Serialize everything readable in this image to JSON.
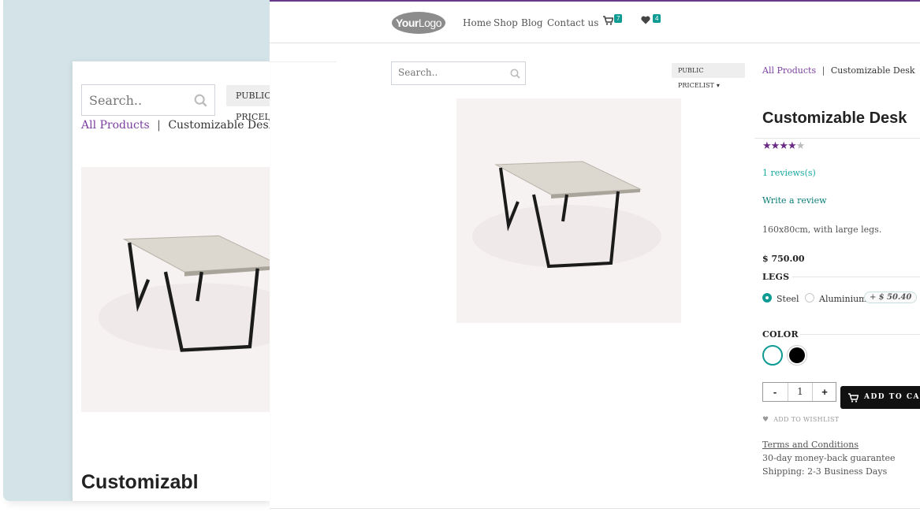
{
  "nav": {
    "logo_bold": "Your",
    "logo_thin": "Logo",
    "links": [
      "Home",
      "Shop",
      "Blog",
      "Contact us"
    ],
    "cart_count": "7",
    "wishlist_count": "4"
  },
  "search": {
    "placeholder": "Search.."
  },
  "pricelist": {
    "label": "PUBLIC PRICELIST"
  },
  "breadcrumb": {
    "parent": "All Products",
    "separator": "|",
    "current": "Customizable Desk"
  },
  "product": {
    "title": "Customizable Desk",
    "rating": 4,
    "rating_max": 5,
    "reviews_label": "1 reviews(s)",
    "write_review_label": "Write a review",
    "description": "160x80cm, with large legs.",
    "price": "$ 750.00",
    "legs_label": "LEGS",
    "legs_options": [
      {
        "label": "Steel",
        "selected": true
      },
      {
        "label": "Aluminium",
        "selected": false,
        "extra_price": "$ 50.40"
      }
    ],
    "extra_prefix": "+",
    "color_label": "COLOR",
    "colors": [
      {
        "name": "white",
        "hex": "#ffffff",
        "selected": true
      },
      {
        "name": "black",
        "hex": "#000000",
        "selected": false
      }
    ],
    "quantity": "1",
    "qty_minus": "-",
    "qty_plus": "+",
    "add_to_cart_label": "ADD TO CART",
    "add_to_wishlist_label": "ADD TO WISHLIST",
    "terms_label": "Terms and Conditions",
    "guarantee": "30-day money-back guarantee",
    "shipping": "Shipping: 2-3 Business Days"
  },
  "mobile": {
    "title_partial": "Customizabl"
  },
  "colors": {
    "accent_purple": "#6b2a86",
    "accent_teal": "#0d9b94",
    "background_panel": "#d3e3e7"
  }
}
